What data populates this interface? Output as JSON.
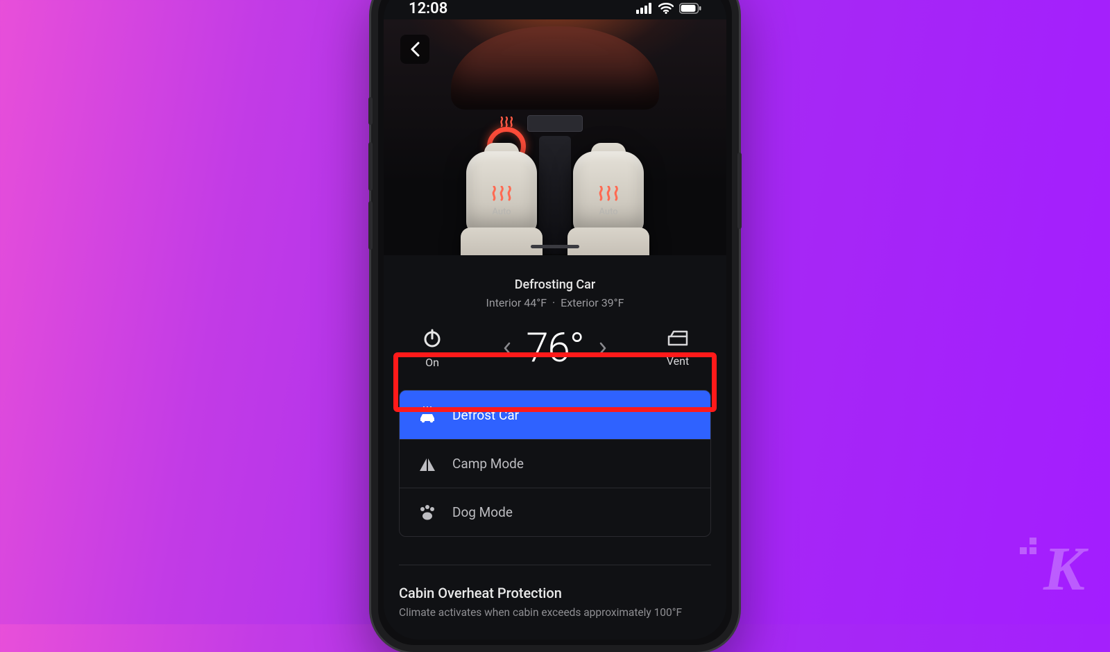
{
  "statusbar": {
    "time": "12:08"
  },
  "seats": {
    "left_mode": "Auto",
    "right_mode": "Auto"
  },
  "climate": {
    "title": "Defrosting Car",
    "interior_label": "Interior 44°F",
    "separator": "·",
    "exterior_label": "Exterior 39°F",
    "power_label": "On",
    "temperature": "76°",
    "vent_label": "Vent"
  },
  "modes": {
    "defrost": "Defrost Car",
    "camp": "Camp Mode",
    "dog": "Dog Mode"
  },
  "overheat": {
    "heading": "Cabin Overheat Protection",
    "desc": "Climate activates when cabin exceeds approximately 100°F"
  },
  "watermark": "K"
}
